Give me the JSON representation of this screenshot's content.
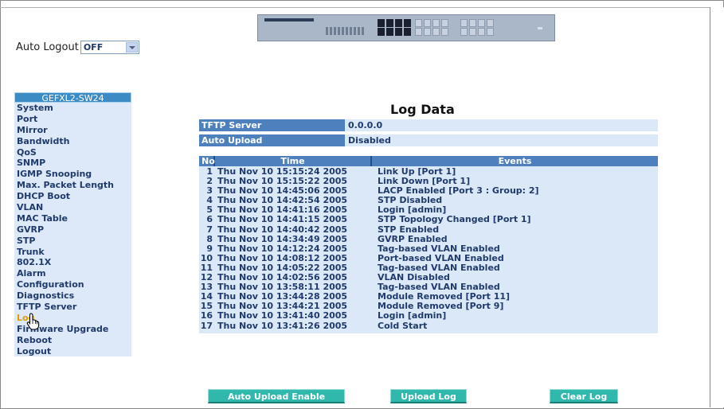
{
  "auto_logout": {
    "label": "Auto Logout",
    "value": "OFF"
  },
  "sidebar": {
    "title": "GEFXL2-SW24",
    "items": [
      {
        "label": "System"
      },
      {
        "label": "Port"
      },
      {
        "label": "Mirror"
      },
      {
        "label": "Bandwidth"
      },
      {
        "label": "QoS"
      },
      {
        "label": "SNMP"
      },
      {
        "label": "IGMP Snooping"
      },
      {
        "label": "Max. Packet Length"
      },
      {
        "label": "DHCP Boot"
      },
      {
        "label": "VLAN"
      },
      {
        "label": "MAC Table"
      },
      {
        "label": "GVRP"
      },
      {
        "label": "STP"
      },
      {
        "label": "Trunk"
      },
      {
        "label": "802.1X"
      },
      {
        "label": "Alarm"
      },
      {
        "label": "Configuration"
      },
      {
        "label": "Diagnostics"
      },
      {
        "label": "TFTP Server"
      },
      {
        "label": "Log"
      },
      {
        "label": "Firmware Upgrade"
      },
      {
        "label": "Reboot"
      },
      {
        "label": "Logout"
      }
    ],
    "active_label": "Log"
  },
  "main": {
    "title": "Log Data",
    "tftp": {
      "label": "TFTP Server",
      "value": "0.0.0.0"
    },
    "auto_upload": {
      "label": "Auto Upload",
      "value": "Disabled"
    },
    "log_headers": {
      "no": "No",
      "time": "Time",
      "events": "Events"
    },
    "log_rows": [
      {
        "no": "1",
        "time": "Thu Nov 10 15:15:24 2005",
        "event": "Link Up [Port 1]"
      },
      {
        "no": "2",
        "time": "Thu Nov 10 15:15:22 2005",
        "event": "Link Down [Port 1]"
      },
      {
        "no": "3",
        "time": "Thu Nov 10 14:45:06 2005",
        "event": "LACP Enabled [Port 3 : Group: 2]"
      },
      {
        "no": "4",
        "time": "Thu Nov 10 14:42:54 2005",
        "event": "STP Disabled"
      },
      {
        "no": "5",
        "time": "Thu Nov 10 14:41:16 2005",
        "event": "Login [admin]"
      },
      {
        "no": "6",
        "time": "Thu Nov 10 14:41:15 2005",
        "event": "STP Topology Changed [Port 1]"
      },
      {
        "no": "7",
        "time": "Thu Nov 10 14:40:42 2005",
        "event": "STP Enabled"
      },
      {
        "no": "8",
        "time": "Thu Nov 10 14:34:49 2005",
        "event": "GVRP Enabled"
      },
      {
        "no": "9",
        "time": "Thu Nov 10 14:12:24 2005",
        "event": "Tag-based VLAN Enabled"
      },
      {
        "no": "10",
        "time": "Thu Nov 10 14:08:12 2005",
        "event": "Port-based VLAN Enabled"
      },
      {
        "no": "11",
        "time": "Thu Nov 10 14:05:22 2005",
        "event": "Tag-based VLAN Enabled"
      },
      {
        "no": "12",
        "time": "Thu Nov 10 14:02:56 2005",
        "event": "VLAN Disabled"
      },
      {
        "no": "13",
        "time": "Thu Nov 10 13:58:11 2005",
        "event": "Tag-based VLAN Enabled"
      },
      {
        "no": "14",
        "time": "Thu Nov 10 13:44:28 2005",
        "event": "Module Removed [Port 11]"
      },
      {
        "no": "15",
        "time": "Thu Nov 10 13:44:21 2005",
        "event": "Module Removed [Port 9]"
      },
      {
        "no": "16",
        "time": "Thu Nov 10 13:41:40 2005",
        "event": "Login [admin]"
      },
      {
        "no": "17",
        "time": "Thu Nov 10 13:41:26 2005",
        "event": "Cold Start"
      }
    ]
  },
  "buttons": {
    "auto_upload_enable": "Auto Upload Enable",
    "upload_log": "Upload Log",
    "clear_log": "Clear Log"
  },
  "colors": {
    "header_blue": "#4d80bd",
    "row_bg": "#dbe8f7",
    "button_teal": "#30b8ad",
    "sidebar_title": "#3d8bc4",
    "active_item": "#e0a000"
  },
  "icons": {
    "cursor": "hand-pointer-icon",
    "dropdown": "chevron-down-icon"
  }
}
